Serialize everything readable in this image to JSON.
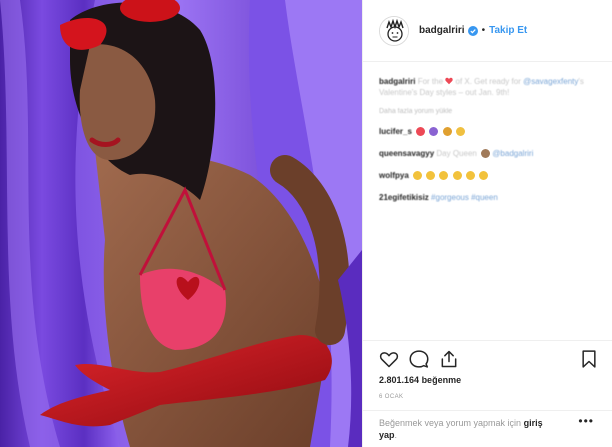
{
  "header": {
    "username": "badgalriri",
    "separator": "•",
    "follow_label": "Takip Et"
  },
  "caption": {
    "username": "badgalriri",
    "text_before": "For the",
    "text_after": "of X. Get ready for",
    "mention": "@savagexfenty",
    "text_end": "'s Valentine's Day styles – out Jan. 9th!"
  },
  "more_comments_label": "Daha fazla yorum yükle",
  "comments": [
    {
      "username": "lucifer_s",
      "text": ""
    },
    {
      "username": "queensavagyy",
      "text": "Day Queen",
      "mention": "@badgalriri"
    },
    {
      "username": "wolfpya",
      "text": ""
    },
    {
      "username": "21egifetikisiz",
      "text": "#gorgeous #queen"
    }
  ],
  "likes": {
    "count": "2.801.164",
    "label": "beğenme"
  },
  "date": "6 OCAK",
  "login": {
    "text": "Beğenmek veya yorum yapmak için",
    "link_part1": "giriş",
    "link_part2": "yap",
    "end": "."
  },
  "more_menu": "•••",
  "colors": {
    "accent": "#3897f0",
    "heart": "#ed4956",
    "curtain": "#6a3bd1",
    "glove": "#c8101a"
  }
}
